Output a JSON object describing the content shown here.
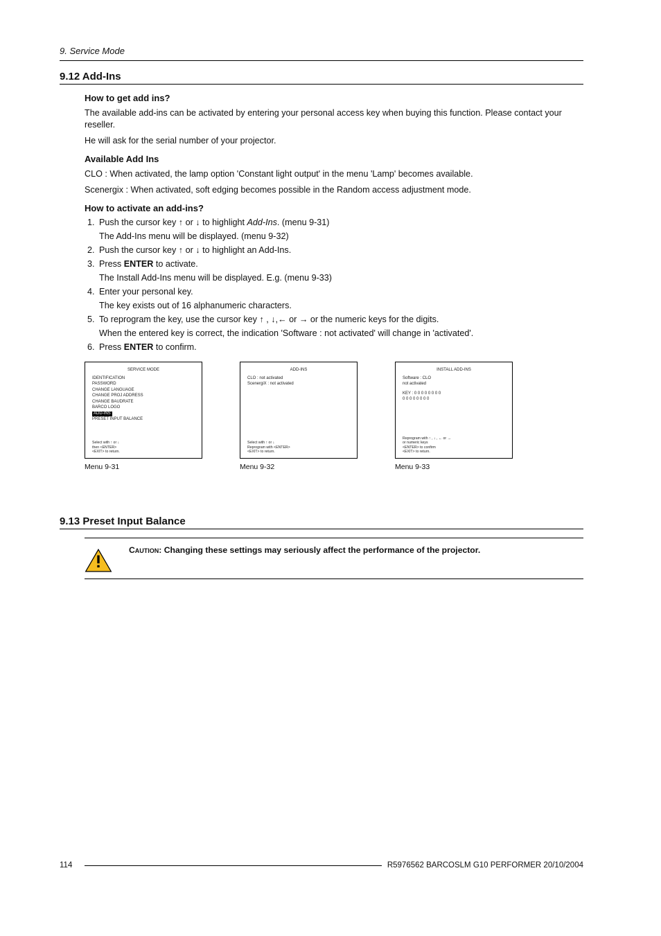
{
  "header": {
    "running": "9.  Service Mode"
  },
  "s912": {
    "title": "9.12 Add-Ins",
    "sub1": "How to get add ins?",
    "p1": "The available add-ins can be activated by entering your personal access key when buying this function. Please contact your reseller.",
    "p2": "He will ask for the serial number of your projector.",
    "sub2": "Available Add Ins",
    "p3": "CLO : When activated, the lamp option 'Constant light output' in the menu 'Lamp' becomes available.",
    "p4": "Scenergix : When activated, soft edging becomes possible in the Random access adjustment mode.",
    "sub3": "How to activate an add-ins?",
    "steps": {
      "s1a": "Push the cursor key ↑ or ↓ to highlight ",
      "s1ital": "Add-Ins",
      "s1b": ".  (menu 9-31)",
      "s1note": "The Add-Ins menu will be displayed.  (menu 9-32)",
      "s2": "Push the cursor key ↑ or ↓ to highlight an Add-Ins.",
      "s3a": "Press ",
      "s3b": "ENTER",
      "s3c": " to activate.",
      "s3note": "The Install Add-Ins menu will be displayed.  E.g.  (menu 9-33)",
      "s4": "Enter your personal key.",
      "s4note": "The key exists out of 16 alphanumeric characters.",
      "s5": "To reprogram the key, use the cursor key ↑ , ↓,← or → or the numeric keys for the digits.",
      "s5note": "When the entered key is correct, the indication 'Software :  not activated' will change in 'activated'.",
      "s6a": "Press ",
      "s6b": "ENTER",
      "s6c": " to confirm."
    },
    "screens": {
      "a": {
        "title": "SERVICE MODE",
        "items": [
          "IDENTIFICATION",
          "PASSWORD",
          "CHANGE LANGUAGE",
          "CHANGE PROJ ADDRESS",
          "CHANGE BAUDRATE",
          "BARCO LOGO"
        ],
        "hl": "ADD-INS",
        "after": "PRESET INPUT BALANCE",
        "foot1": "Select with ↑ or ↓",
        "foot2": "then <ENTER>",
        "foot3": "<EXIT> to return.",
        "cap": "Menu 9-31"
      },
      "b": {
        "title": "ADD-INS",
        "items": [
          "CLO  : not activated",
          "ScenergiX  :  not activated"
        ],
        "foot1": "Select with ↑ or ↓",
        "foot2": "Reprogram with <ENTER>",
        "foot3": "<EXIT> to return.",
        "cap": "Menu 9-32"
      },
      "c": {
        "title": "INSTALL ADD-INS",
        "line1": "Software : CLO",
        "line2": "not activated",
        "line3": "KEY : 0 0 0 0 0 0 0 0",
        "line4": "        0 0 0 0 0 0 0 0",
        "foot1": "Reprogram with ↑ , ↓ , ← or →",
        "foot2": "or numeric keys",
        "foot3": "<ENTER> to confirm",
        "foot4": "<EXIT> to return.",
        "cap": "Menu 9-33"
      }
    }
  },
  "s913": {
    "title": "9.13 Preset Input Balance",
    "cautionLabel": "Caution: ",
    "cautionText": "Changing these settings may seriously affect the performance of the projector."
  },
  "footer": {
    "page": "114",
    "doc": "R5976562  BARCOSLM G10 PERFORMER  20/10/2004"
  }
}
